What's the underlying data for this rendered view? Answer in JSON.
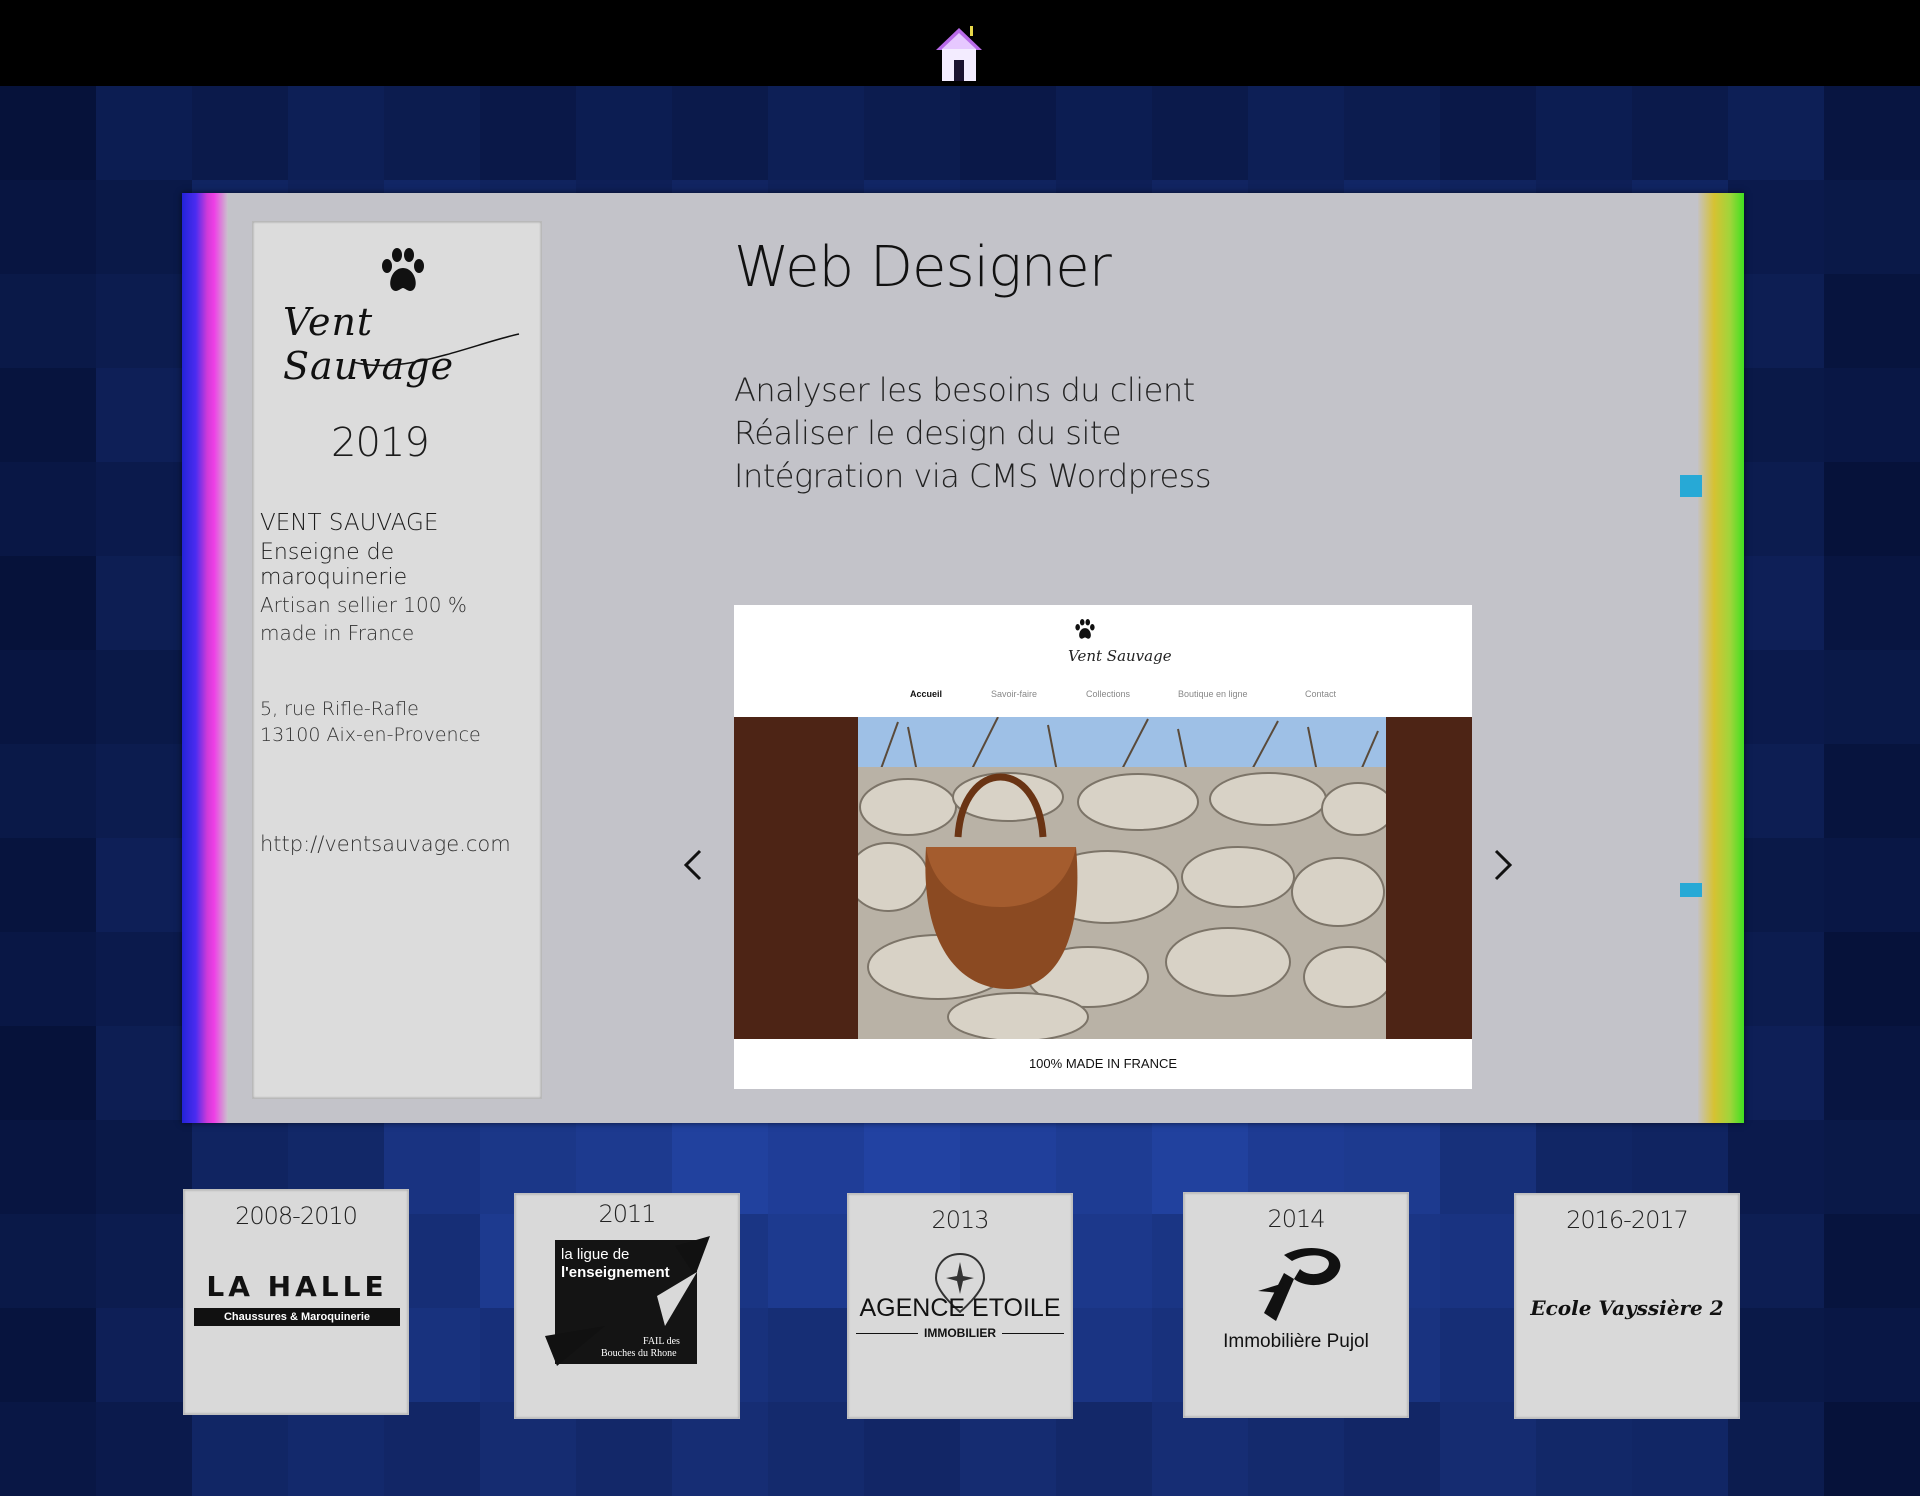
{
  "colors": {
    "accent_blue": "#27a9d6",
    "banner_brown": "#4d2415",
    "card": "#dcdcdc"
  },
  "header": {
    "home_icon": "home-icon"
  },
  "project": {
    "logo_text": "Vent Sauvage",
    "year": "2019",
    "client_name": "VENT SAUVAGE",
    "client_desc": "Enseigne de maroquinerie",
    "tagline_1": "Artisan sellier 100 %",
    "tagline_2": "made in France",
    "address_1": "5, rue Rifle-Rafle",
    "address_2": "13100 Aix-en-Provence",
    "url": "http://ventsauvage.com"
  },
  "role": {
    "title": "Web Designer",
    "tasks": [
      "Analyser les besoins du client",
      "Réaliser le design du site",
      "Intégration via CMS Wordpress"
    ]
  },
  "preview": {
    "logo_text": "Vent Sauvage",
    "nav": [
      "Accueil",
      "Savoir-faire",
      "Collections",
      "Boutique en ligne",
      "Contact"
    ],
    "footer": "100% MADE IN FRANCE"
  },
  "experiences": [
    {
      "year": "2008-2010",
      "logo_text_1": "LA HALLE",
      "logo_text_2": "Chaussures & Maroquinerie"
    },
    {
      "year": "2011",
      "logo_text_1": "la ligue de",
      "logo_text_2": "l'enseignement",
      "logo_text_3": "FAIL des",
      "logo_text_4": "Bouches du Rhone"
    },
    {
      "year": "2013",
      "logo_text_1": "AGENCE ETOILE",
      "logo_text_2": "IMMOBILIER"
    },
    {
      "year": "2014",
      "logo_text_1": "Immobilière Pujol"
    },
    {
      "year": "2016-2017",
      "logo_text_1": "Ecole Vayssière 2"
    }
  ]
}
